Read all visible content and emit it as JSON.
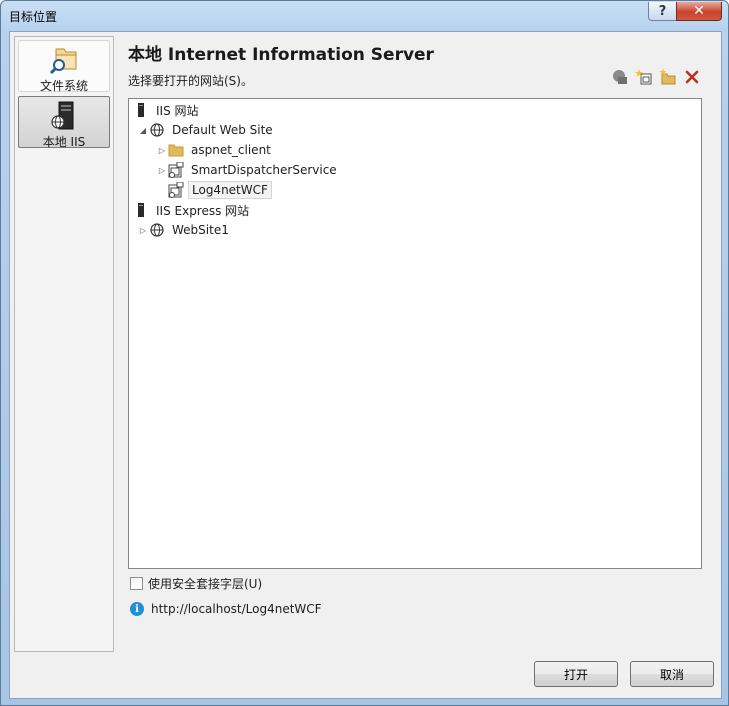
{
  "window": {
    "title": "目标位置",
    "help_label": "?",
    "close_label": "✕"
  },
  "sidebar": {
    "items": [
      {
        "label": "文件系统",
        "icon": "file-system-icon"
      },
      {
        "label": "本地 IIS",
        "icon": "local-iis-server-icon",
        "selected": true
      }
    ]
  },
  "panel": {
    "title": "本地 Internet Information Server",
    "subtitle": "选择要打开的网站(S)。"
  },
  "toolbar": {
    "buttons": [
      "connect-icon",
      "new-web-application-icon",
      "new-virtual-directory-icon",
      "delete-icon"
    ]
  },
  "tree": {
    "nodes": [
      {
        "label": "IIS 网站",
        "icon": "server-icon"
      },
      {
        "label": "Default Web Site",
        "icon": "globe-icon",
        "expanded": true
      },
      {
        "label": "aspnet_client",
        "icon": "folder-icon"
      },
      {
        "label": "SmartDispatcherService",
        "icon": "web-application-icon"
      },
      {
        "label": "Log4netWCF",
        "icon": "web-application-icon",
        "selected": true
      },
      {
        "label": "IIS Express 网站",
        "icon": "server-icon"
      },
      {
        "label": "WebSite1",
        "icon": "globe-icon"
      }
    ]
  },
  "ssl": {
    "label": "使用安全套接字层(U)",
    "checked": false
  },
  "info": {
    "url": "http://localhost/Log4netWCF"
  },
  "buttons": {
    "open": "打开",
    "cancel": "取消"
  },
  "colors": {
    "title_bar": "#b7d2ee",
    "close_button": "#c7452c",
    "delete_icon": "#b8321f",
    "info_icon": "#1f8fd6",
    "folder": "#e2b95c"
  }
}
